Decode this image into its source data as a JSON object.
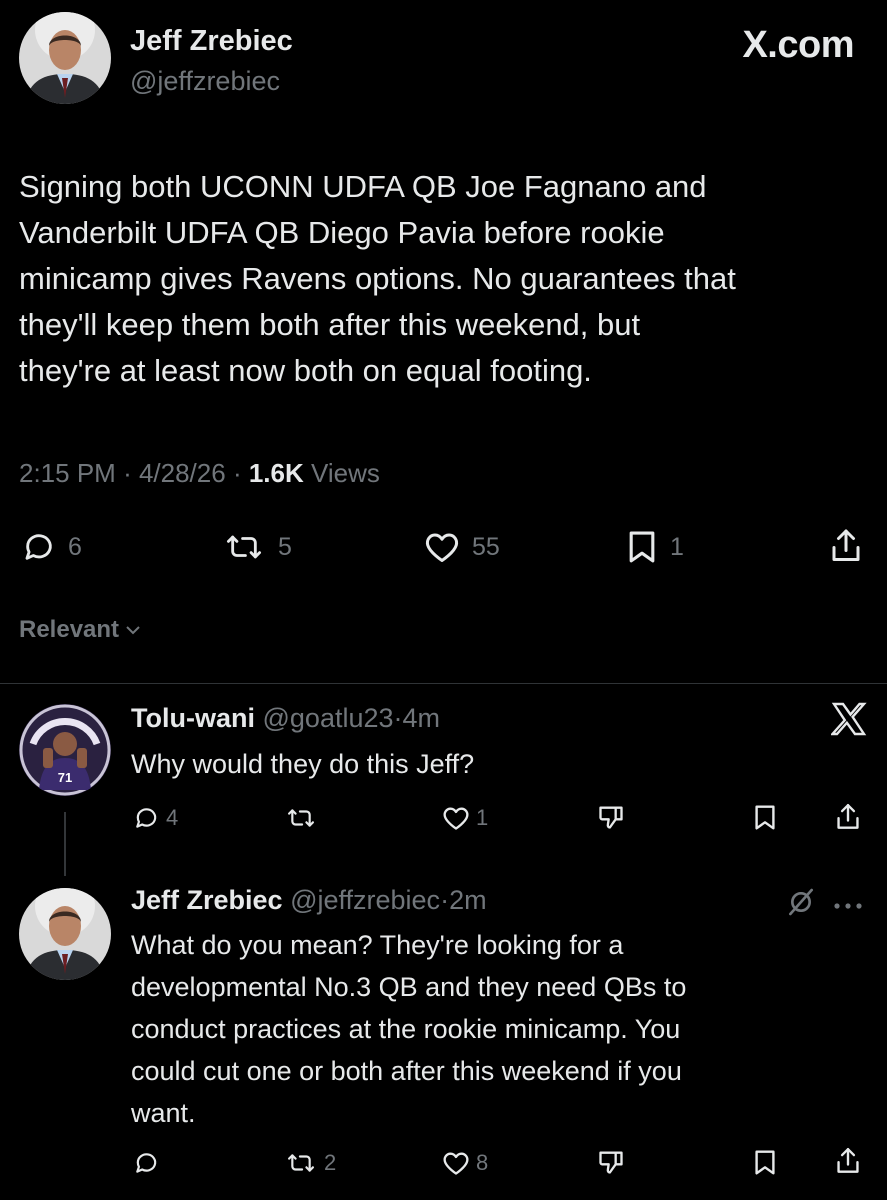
{
  "main_tweet": {
    "author_name": "Jeff Zrebiec",
    "author_handle": "@jeffzrebiec",
    "brand": "X.com",
    "text": "Signing both UCONN UDFA QB Joe Fagnano and\nVanderbilt UDFA QB Diego Pavia before rookie\nminicamp gives Ravens options. No guarantees that\nthey'll keep them both after this weekend, but\nthey're at least now both on equal footing.",
    "time": "2:15 PM",
    "date": "4/28/26",
    "views_count": "1.6K",
    "views_label": "Views",
    "replies": "6",
    "reposts": "5",
    "likes": "55",
    "bookmarks": "1"
  },
  "sort": {
    "label": "Relevant"
  },
  "replies": [
    {
      "name": "Tolu-wani",
      "handle": "@goatlu23",
      "age": "4m",
      "text": "Why would they do this Jeff?",
      "replies": "4",
      "reposts": "",
      "likes": "1",
      "jersey_number": "71"
    },
    {
      "name": "Jeff Zrebiec",
      "handle": "@jeffzrebiec",
      "age": "2m",
      "text": "What do you mean? They're looking for a\ndevelopmental No.3 QB and they need QBs to\nconduct practices at the rookie minicamp. You\ncould cut one or both after this weekend if you\nwant.",
      "replies": "",
      "reposts": "2",
      "likes": "8"
    }
  ],
  "colors": {
    "background": "#000000",
    "primary_text": "#e7e9ea",
    "secondary_text": "#71767b",
    "divider": "#2f3336"
  },
  "icons": [
    "reply-icon",
    "repost-icon",
    "like-icon",
    "bookmark-icon",
    "share-icon",
    "x-logo-icon",
    "dislike-icon",
    "grok-icon",
    "more-icon",
    "chevron-down-icon"
  ]
}
